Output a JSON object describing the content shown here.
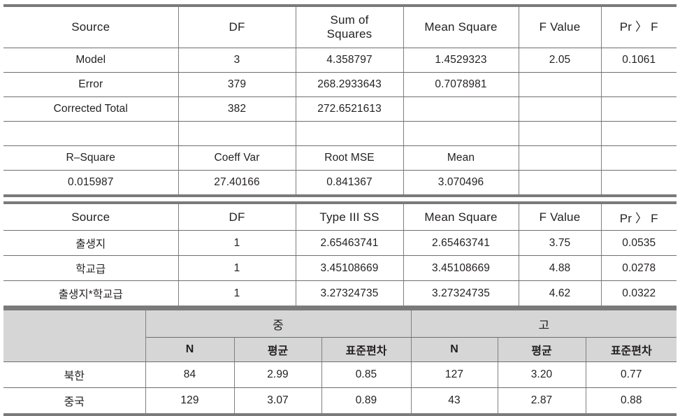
{
  "anova_overall": {
    "columns": [
      "Source",
      "DF",
      "Sum of\nSquares",
      "Mean Square",
      "F Value",
      "Pr > F"
    ],
    "column_labels": {
      "source": "Source",
      "df": "DF",
      "ss_line1": "Sum of",
      "ss_line2": "Squares",
      "mean_square": "Mean Square",
      "f_value": "F Value",
      "pr_f": "Pr 〉 F"
    },
    "rows": [
      {
        "source": "Model",
        "df": "3",
        "ss": "4.358797",
        "ms": "1.4529323",
        "f": "2.05",
        "p": "0.1061"
      },
      {
        "source": "Error",
        "df": "379",
        "ss": "268.2933643",
        "ms": "0.7078981",
        "f": "",
        "p": ""
      },
      {
        "source": "Corrected  Total",
        "df": "382",
        "ss": "272.6521613",
        "ms": "",
        "f": "",
        "p": ""
      },
      {
        "source": "",
        "df": "",
        "ss": "",
        "ms": "",
        "f": "",
        "p": ""
      }
    ],
    "fit_stats": {
      "headers": [
        "R-Square",
        "Coeff Var",
        "Root MSE",
        "Mean",
        "",
        ""
      ],
      "header_labels": {
        "r_square": "R–Square",
        "coeff_var": "Coeff Var",
        "root_mse": "Root MSE",
        "mean": "Mean",
        "blank5": "",
        "blank6": ""
      },
      "values": {
        "r_square": "0.015987",
        "coeff_var": "27.40166",
        "root_mse": "0.841367",
        "mean": "3.070496",
        "blank5": "",
        "blank6": ""
      }
    }
  },
  "anova_type3": {
    "column_labels": {
      "source": "Source",
      "df": "DF",
      "type3_ss": "Type III SS",
      "mean_square": "Mean Square",
      "f_value": "F Value",
      "pr_f": "Pr 〉 F"
    },
    "rows": [
      {
        "source": "출생지",
        "df": "1",
        "ss": "2.65463741",
        "ms": "2.65463741",
        "f": "3.75",
        "p": "0.0535"
      },
      {
        "source": "학교급",
        "df": "1",
        "ss": "3.45108669",
        "ms": "3.45108669",
        "f": "4.88",
        "p": "0.0278"
      },
      {
        "source": "출생지*학교급",
        "df": "1",
        "ss": "3.27324735",
        "ms": "3.27324735",
        "f": "4.62",
        "p": "0.0322"
      }
    ]
  },
  "descriptives": {
    "corner_label": "",
    "groups": [
      {
        "label": "중",
        "sub_headers": [
          "N",
          "평균",
          "표준편차"
        ]
      },
      {
        "label": "고",
        "sub_headers": [
          "N",
          "평균",
          "표준편차"
        ]
      }
    ],
    "rows": [
      {
        "label": "북한",
        "mid_n": "84",
        "mid_mean": "2.99",
        "mid_sd": "0.85",
        "high_n": "127",
        "high_mean": "3.20",
        "high_sd": "0.77"
      },
      {
        "label": "중국",
        "mid_n": "129",
        "mid_mean": "3.07",
        "mid_sd": "0.89",
        "high_n": "43",
        "high_mean": "2.87",
        "high_sd": "0.88"
      }
    ]
  },
  "colors": {
    "header_fill": "#d6d6d6",
    "rule": "#7a7a7a",
    "grid": "#808080",
    "text": "#231f20"
  }
}
